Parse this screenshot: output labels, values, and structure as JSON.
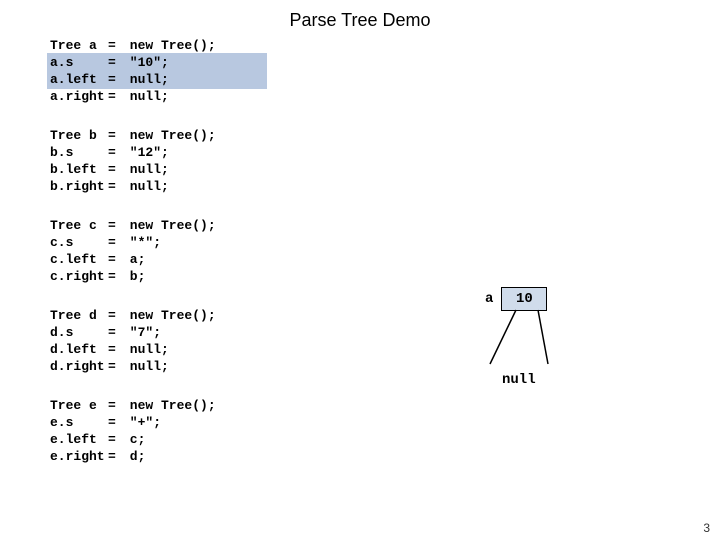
{
  "title": "Parse Tree Demo",
  "blocks": [
    {
      "decl": "Tree a",
      "new": "new Tree();",
      "s_lhs": "a.s",
      "s_val": "\"10\";",
      "l_lhs": "a.left",
      "l_val": "null;",
      "r_lhs": "a.right",
      "r_val": "null;",
      "highlight": true
    },
    {
      "decl": "Tree b",
      "new": "new Tree();",
      "s_lhs": "b.s",
      "s_val": "\"12\";",
      "l_lhs": "b.left",
      "l_val": "null;",
      "r_lhs": "b.right",
      "r_val": "null;",
      "highlight": false
    },
    {
      "decl": "Tree c",
      "new": "new Tree();",
      "s_lhs": "c.s",
      "s_val": "\"*\";",
      "l_lhs": "c.left",
      "l_val": "a;",
      "r_lhs": "c.right",
      "r_val": "b;",
      "highlight": false
    },
    {
      "decl": "Tree d",
      "new": "new Tree();",
      "s_lhs": "d.s",
      "s_val": "\"7\";",
      "l_lhs": "d.left",
      "l_val": "null;",
      "r_lhs": "d.right",
      "r_val": "null;",
      "highlight": false
    },
    {
      "decl": "Tree e",
      "new": "new Tree();",
      "s_lhs": "e.s",
      "s_val": "\"+\";",
      "l_lhs": "e.left",
      "l_val": "c;",
      "r_lhs": "e.right",
      "r_val": "d;",
      "highlight": false
    }
  ],
  "diagram": {
    "node_label": "a",
    "node_value": "10",
    "child_label": "null"
  },
  "pagenum": "3"
}
